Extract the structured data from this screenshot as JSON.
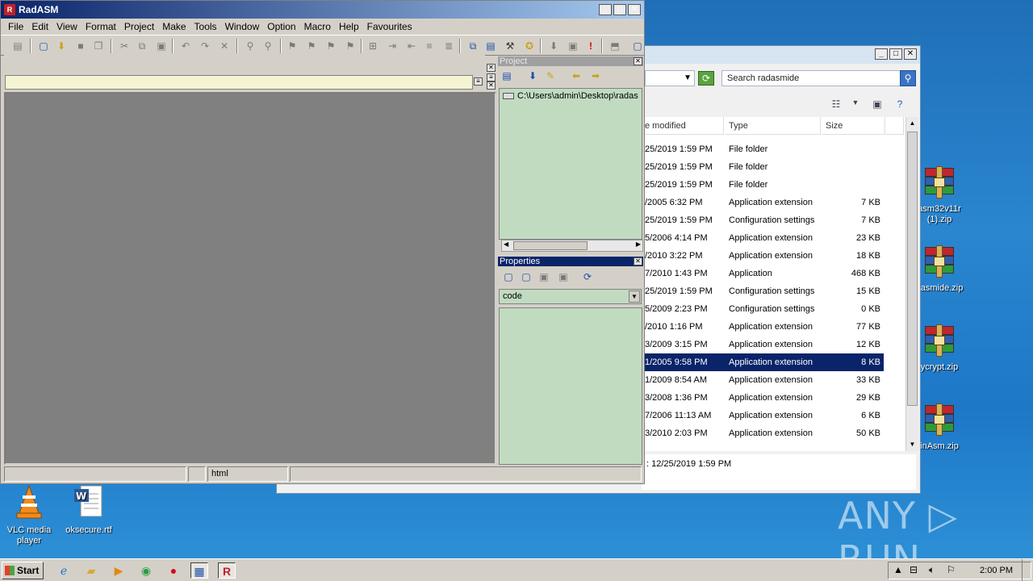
{
  "desktop": {
    "icons_right": [
      {
        "label": "asm32v11r (1).zip"
      },
      {
        "label": "dasmide.zip"
      },
      {
        "label": "ycrypt.zip"
      },
      {
        "label": "inAsm.zip"
      }
    ],
    "icons_bottom": [
      {
        "label": "VLC media player"
      },
      {
        "label": "oksecure.rtf"
      }
    ],
    "watermark": "ANY ▷ RUN"
  },
  "explorer": {
    "search_placeholder": "Search radasmide",
    "columns": [
      "e modified",
      "Type",
      "Size"
    ],
    "rows": [
      {
        "date": "25/2019 1:59 PM",
        "type": "File folder",
        "size": ""
      },
      {
        "date": "25/2019 1:59 PM",
        "type": "File folder",
        "size": ""
      },
      {
        "date": "25/2019 1:59 PM",
        "type": "File folder",
        "size": ""
      },
      {
        "date": "/2005 6:32 PM",
        "type": "Application extension",
        "size": "7 KB"
      },
      {
        "date": "25/2019 1:59 PM",
        "type": "Configuration settings",
        "size": "7 KB"
      },
      {
        "date": "5/2006 4:14 PM",
        "type": "Application extension",
        "size": "23 KB"
      },
      {
        "date": "/2010 3:22 PM",
        "type": "Application extension",
        "size": "18 KB"
      },
      {
        "date": "7/2010 1:43 PM",
        "type": "Application",
        "size": "468 KB"
      },
      {
        "date": "25/2019 1:59 PM",
        "type": "Configuration settings",
        "size": "15 KB"
      },
      {
        "date": "5/2009 2:23 PM",
        "type": "Configuration settings",
        "size": "0 KB"
      },
      {
        "date": "/2010 1:16 PM",
        "type": "Application extension",
        "size": "77 KB"
      },
      {
        "date": "3/2009 3:15 PM",
        "type": "Application extension",
        "size": "12 KB"
      },
      {
        "date": "1/2005 9:58 PM",
        "type": "Application extension",
        "size": "8 KB",
        "selected": true
      },
      {
        "date": "1/2009 8:54 AM",
        "type": "Application extension",
        "size": "33 KB"
      },
      {
        "date": "3/2008 1:36 PM",
        "type": "Application extension",
        "size": "29 KB"
      },
      {
        "date": "7/2006 11:13 AM",
        "type": "Application extension",
        "size": "6 KB"
      },
      {
        "date": "3/2010 2:03 PM",
        "type": "Application extension",
        "size": "50 KB"
      }
    ],
    "details": ": 12/25/2019 1:59 PM"
  },
  "radasm": {
    "title": "RadASM",
    "menu": [
      "File",
      "Edit",
      "View",
      "Format",
      "Project",
      "Make",
      "Tools",
      "Window",
      "Option",
      "Macro",
      "Help",
      "Favourites"
    ],
    "project_panel_title": "Project",
    "project_path": "C:\\Users\\admin\\Desktop\\radas",
    "properties_panel_title": "Properties",
    "properties_combo_value": "code",
    "status_cells": [
      "",
      "",
      "html"
    ]
  },
  "taskbar": {
    "start_label": "Start",
    "clock": "2:00 PM"
  }
}
